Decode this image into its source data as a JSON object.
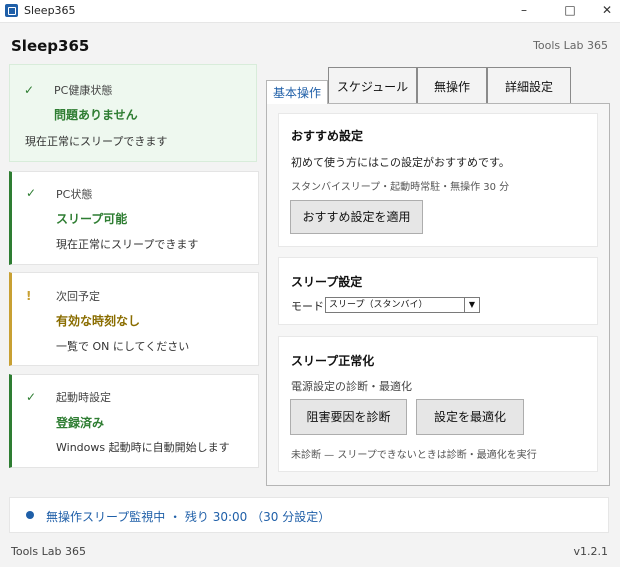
{
  "window": {
    "title": "Sleep365",
    "minimize": "–",
    "maximize": "□",
    "close": "✕"
  },
  "header": {
    "title": "Sleep365",
    "brand": "Tools Lab 365"
  },
  "cards": [
    {
      "mark": "✓",
      "label": "PC健康状態",
      "status": "問題ありません",
      "desc": "現在正常にスリープできます",
      "status_color": "#2e7d32"
    },
    {
      "mark": "✓",
      "label": "PC状態",
      "status": "スリープ可能",
      "desc": "現在正常にスリープできます",
      "status_color": "#2e7d32"
    },
    {
      "mark": "!",
      "label": "次回予定",
      "status": "有効な時刻なし",
      "desc": "一覧で ON にしてください",
      "status_color": "#8a6d00"
    },
    {
      "mark": "✓",
      "label": "起動時設定",
      "status": "登録済み",
      "desc": "Windows 起動時に自動開始します",
      "status_color": "#2e7d32"
    }
  ],
  "tabs": [
    "基本操作",
    "スケジュール",
    "無操作",
    "詳細設定"
  ],
  "recommend": {
    "title": "おすすめ設定",
    "text": "初めて使う方にはこの設定がおすすめです。",
    "sub": "スタンバイスリープ・起動時常駐・無操作 30 分",
    "button": "おすすめ設定を適用"
  },
  "sleep_settings": {
    "title": "スリープ設定",
    "mode_label": "モード:",
    "mode_value": "スリープ（スタンバイ）",
    "arrow": "▼"
  },
  "normalize": {
    "title": "スリープ正常化",
    "text": "電源設定の診断・最適化",
    "diagnose_button": "阻害要因を診断",
    "optimize_button": "設定を最適化",
    "sub": "未診断 — スリープできないときは診断・最適化を実行"
  },
  "statusbar": {
    "text": "無操作スリープ監視中 ・ 残り 30:00 （30 分設定）"
  },
  "footer": {
    "brand": "Tools Lab 365",
    "version": "v1.2.1"
  },
  "colors": {
    "accent": "#1f5fa8",
    "good": "#2e7d32",
    "warn": "#c8a033"
  }
}
